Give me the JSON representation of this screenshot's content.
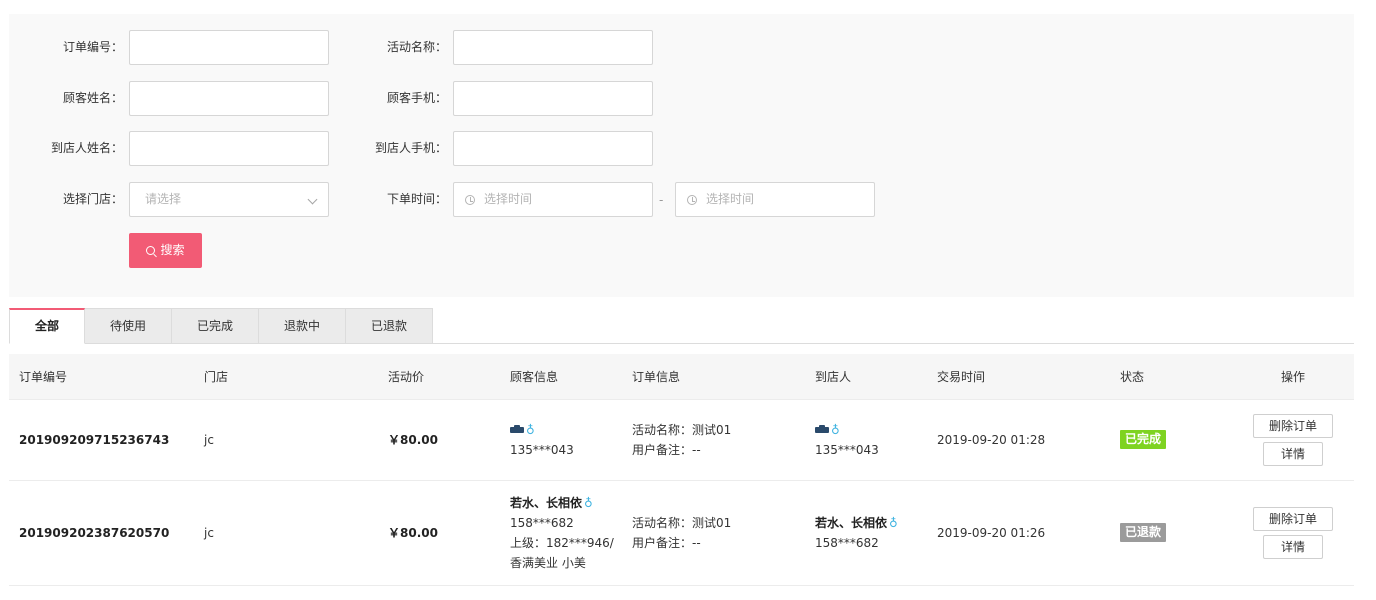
{
  "filters": {
    "order_no_label": "订单编号：",
    "activity_name_label": "活动名称：",
    "customer_name_label": "顾客姓名：",
    "customer_phone_label": "顾客手机：",
    "visitor_name_label": "到店人姓名：",
    "visitor_phone_label": "到店人手机：",
    "store_label": "选择门店：",
    "store_placeholder": "请选择",
    "order_time_label": "下单时间：",
    "start_time_placeholder": "选择时间",
    "time_separator": "-",
    "end_time_placeholder": "选择时间",
    "search_button": "搜索"
  },
  "tabs": [
    "全部",
    "待使用",
    "已完成",
    "退款中",
    "已退款"
  ],
  "table": {
    "headers": {
      "order_no": "订单编号",
      "store": "门店",
      "price": "活动价",
      "customer": "顾客信息",
      "order_info": "订单信息",
      "visitor": "到店人",
      "trade_time": "交易时间",
      "status": "状态",
      "actions": "操作"
    },
    "rows": [
      {
        "order_no": "201909209715236743",
        "store": "jc",
        "price": "￥80.00",
        "customer_name": "",
        "customer_gender": "♁",
        "customer_phone": "135***043",
        "customer_parent": "",
        "customer_parent_store": "",
        "activity": "活动名称：测试01",
        "remark": "用户备注：--",
        "visitor_name": "",
        "visitor_gender": "♁",
        "visitor_phone": "135***043",
        "trade_time": "2019-09-20 01:28",
        "status": "已完成",
        "delete_label": "删除订单",
        "detail_label": "详情"
      },
      {
        "order_no": "201909202387620570",
        "store": "jc",
        "price": "￥80.00",
        "customer_name": "若水、长相依",
        "customer_gender": "♁",
        "customer_phone": "158***682",
        "customer_parent": "上级：182***946/",
        "customer_parent_store": "香满美业 小美",
        "activity": "活动名称：测试01",
        "remark": "用户备注：--",
        "visitor_name": "若水、长相依",
        "visitor_gender": "♁",
        "visitor_phone": "158***682",
        "trade_time": "2019-09-20 01:26",
        "status": "已退款",
        "delete_label": "删除订单",
        "detail_label": "详情"
      }
    ]
  },
  "colors": {
    "accent": "#f25b75",
    "status_done": "#7ed321",
    "status_refunded": "#9b9b9b"
  }
}
